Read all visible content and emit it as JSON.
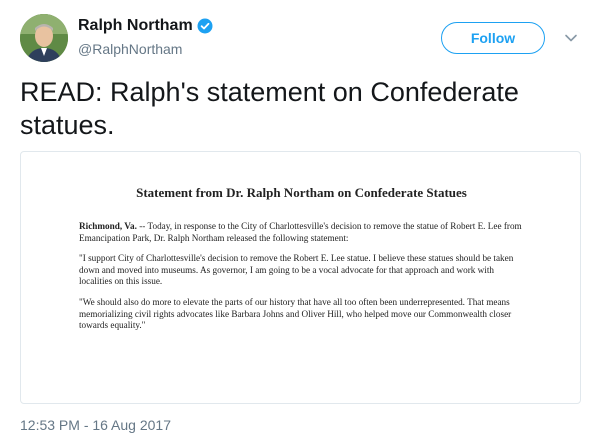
{
  "author": {
    "display_name": "Ralph Northam",
    "handle": "@RalphNortham",
    "verified": true,
    "avatar_icon": "avatar-photo"
  },
  "actions": {
    "follow_label": "Follow",
    "menu_icon": "chevron-down-icon"
  },
  "tweet": {
    "text": "READ: Ralph's statement on Confederate statues.",
    "timestamp": "12:53 PM - 16 Aug 2017"
  },
  "statement": {
    "title": "Statement from Dr. Ralph Northam on Confederate Statues",
    "location": "Richmond, Va.",
    "intro": " -- Today, in response to the City of Charlottesville's decision to remove the statue of Robert E. Lee from Emancipation Park, Dr. Ralph Northam released the following statement:",
    "paragraph_1": "\"I support City of Charlottesville's decision to remove the Robert E. Lee statue. I believe these statues should be taken down and moved into museums. As governor, I am going to be a vocal advocate for that approach and work with localities on this issue.",
    "paragraph_2": "\"We should also do more to elevate the parts of our history that have all too often been underrepresented. That means memorializing civil rights advocates like Barbara Johns and Oliver Hill, who helped move our Commonwealth closer towards equality.\""
  },
  "colors": {
    "accent": "#1da1f2",
    "secondary_text": "#657786",
    "border": "#e1e8ed"
  }
}
